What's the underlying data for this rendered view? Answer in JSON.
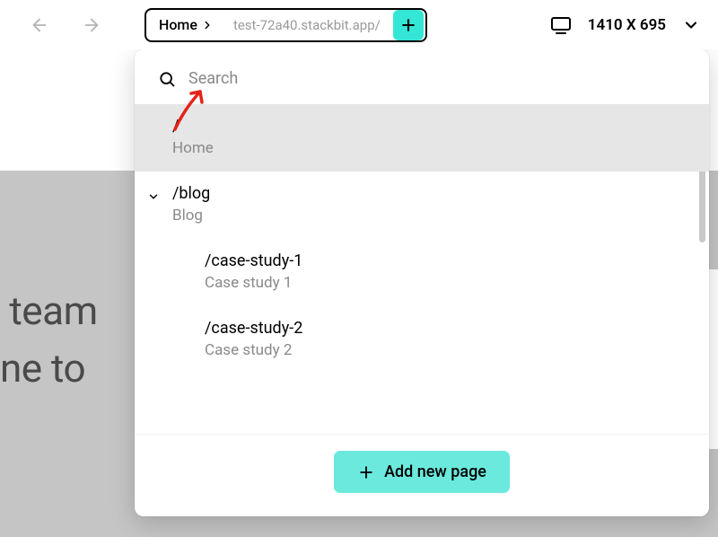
{
  "toolbar": {
    "breadcrumb_label": "Home",
    "url": "test-72a40.stackbit.app/",
    "viewport_label": "1410 X 695"
  },
  "panel": {
    "search_placeholder": "Search",
    "add_page_label": "Add new page",
    "pages": [
      {
        "path": "/",
        "title": "Home",
        "selected": true,
        "level": 1,
        "expandable": false
      },
      {
        "path": "/blog",
        "title": "Blog",
        "selected": false,
        "level": 1,
        "expandable": true
      },
      {
        "path": "/case-study-1",
        "title": "Case study 1",
        "selected": false,
        "level": 2,
        "expandable": false
      },
      {
        "path": "/case-study-2",
        "title": "Case study 2",
        "selected": false,
        "level": 2,
        "expandable": false
      }
    ]
  },
  "hero": {
    "line1": " team",
    "line2": "ne to"
  }
}
